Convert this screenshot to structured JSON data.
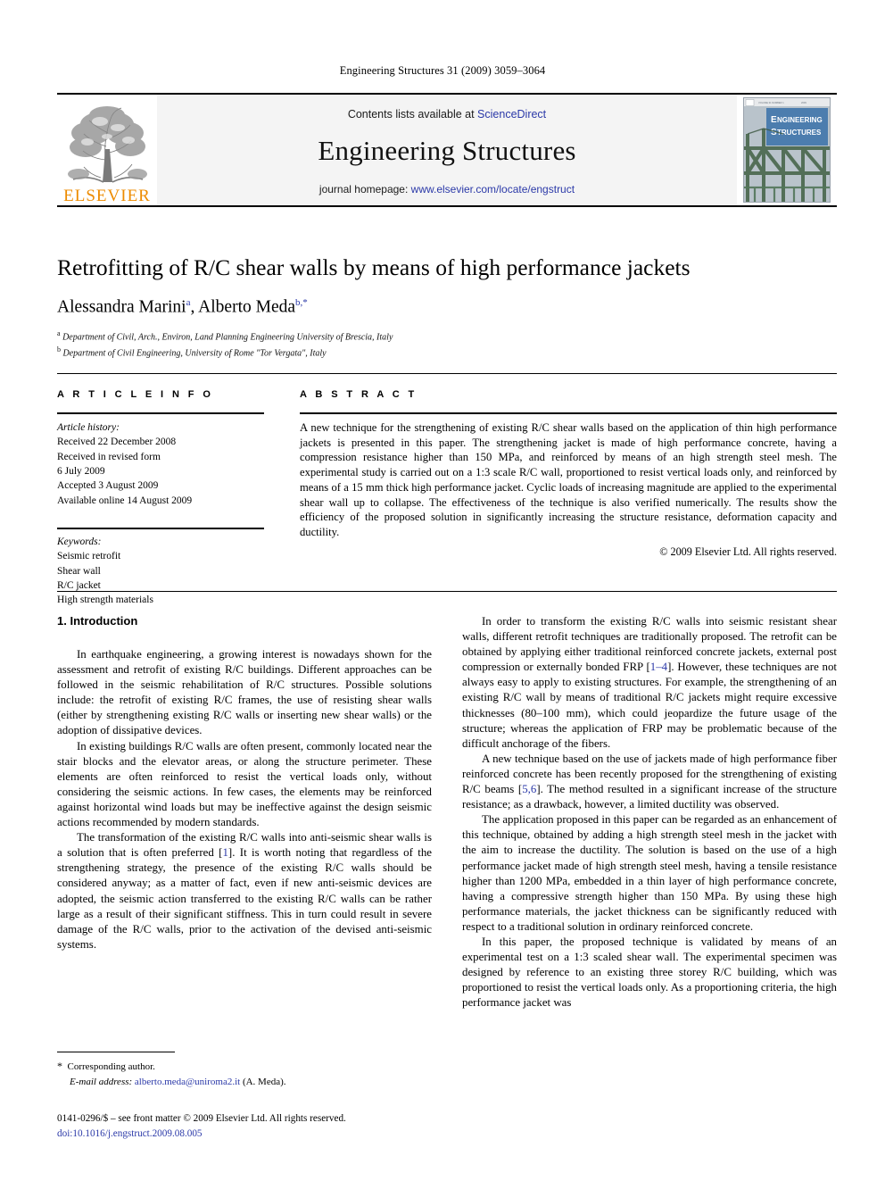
{
  "running_head": "Engineering Structures 31 (2009) 3059–3064",
  "masthead": {
    "publisher_name": "ELSEVIER",
    "publisher_logo_icon": "elsevier-tree-icon",
    "contents_prefix": "Contents lists available at ",
    "contents_link": "ScienceDirect",
    "journal_name": "Engineering Structures",
    "homepage_prefix": "journal homepage: ",
    "homepage_url": "www.elsevier.com/locate/engstruct",
    "cover_title_line1": "ENGINEERING",
    "cover_title_line2": "STRUCTURES",
    "link_color": "#2b39a8",
    "elsevier_orange": "#ED8B00",
    "cover_band_color": "#4a7eb5"
  },
  "article": {
    "title": "Retrofitting of R/C shear walls by means of high performance jackets",
    "authors": [
      {
        "name": "Alessandra Marini",
        "marker": "a"
      },
      {
        "name": "Alberto Meda",
        "marker": "b,*"
      }
    ],
    "affiliations": [
      {
        "marker": "a",
        "text": "Department of Civil, Arch., Environ, Land Planning Engineering University of Brescia, Italy"
      },
      {
        "marker": "b",
        "text": "Department of Civil Engineering, University of Rome \"Tor Vergata\", Italy"
      }
    ]
  },
  "article_info": {
    "heading": "A R T I C L E    I N F O",
    "history_label": "Article history:",
    "history": [
      "Received 22 December 2008",
      "Received in revised form",
      "6 July 2009",
      "Accepted 3 August 2009",
      "Available online 14 August 2009"
    ],
    "keywords_label": "Keywords:",
    "keywords": [
      "Seismic retrofit",
      "Shear wall",
      "R/C jacket",
      "High strength materials"
    ]
  },
  "abstract": {
    "heading": "A B S T R A C T",
    "text": "A new technique for the strengthening of existing R/C shear walls based on the application of thin high performance jackets is presented in this paper. The strengthening jacket is made of high performance concrete, having a compression resistance higher than 150 MPa, and reinforced by means of an high strength steel mesh. The experimental study is carried out on a 1:3 scale R/C wall, proportioned to resist vertical loads only, and reinforced by means of a 15 mm thick high performance jacket. Cyclic loads of increasing magnitude are applied to the experimental shear wall up to collapse. The effectiveness of the technique is also verified numerically. The results show the efficiency of the proposed solution in significantly increasing the structure resistance, deformation capacity and ductility.",
    "copyright": "© 2009 Elsevier Ltd. All rights reserved."
  },
  "body": {
    "section_heading": "1. Introduction",
    "left_paragraphs": [
      "In earthquake engineering, a growing interest is nowadays shown for the assessment and retrofit of existing R/C buildings. Different approaches can be followed in the seismic rehabilitation of R/C structures. Possible solutions include: the retrofit of existing R/C frames, the use of resisting shear walls (either by strengthening existing R/C walls or inserting new shear walls) or the adoption of dissipative devices.",
      "In existing buildings R/C walls are often present, commonly located near the stair blocks and the elevator areas, or along the structure perimeter. These elements are often reinforced to resist the vertical loads only, without considering the seismic actions. In few cases, the elements may be reinforced against horizontal wind loads but may be ineffective against the design seismic actions recommended by modern standards.",
      "The transformation of the existing R/C walls into anti-seismic shear walls is a solution that is often preferred [1]. It is worth noting that regardless of the strengthening strategy, the presence of the existing R/C walls should be considered anyway; as a matter of fact, even if new anti-seismic devices are adopted, the seismic action transferred to the existing R/C walls can be rather large as a result of their significant stiffness. This in turn could result in severe damage of the R/C walls, prior to the activation of the devised anti-seismic systems."
    ],
    "right_paragraphs": [
      "In order to transform the existing R/C walls into seismic resistant shear walls, different retrofit techniques are traditionally proposed. The retrofit can be obtained by applying either traditional reinforced concrete jackets, external post compression or externally bonded FRP [1–4]. However, these techniques are not always easy to apply to existing structures. For example, the strengthening of an existing R/C wall by means of traditional R/C jackets might require excessive thicknesses (80–100 mm), which could jeopardize the future usage of the structure; whereas the application of FRP may be problematic because of the difficult anchorage of the fibers.",
      "A new technique based on the use of jackets made of high performance fiber reinforced concrete has been recently proposed for the strengthening of existing R/C beams [5,6]. The method resulted in a significant increase of the structure resistance; as a drawback, however, a limited ductility was observed.",
      "The application proposed in this paper can be regarded as an enhancement of this technique, obtained by adding a high strength steel mesh in the jacket with the aim to increase the ductility. The solution is based on the use of a high performance jacket made of high strength steel mesh, having a tensile resistance higher than 1200 MPa, embedded in a thin layer of high performance concrete, having a compressive strength higher than 150 MPa. By using these high performance  materials, the jacket thickness can be significantly reduced with respect to a traditional solution in ordinary reinforced concrete.",
      "In this paper, the proposed technique is validated by means of an experimental test on a 1:3 scaled shear wall. The experimental specimen was designed by reference to an existing three storey R/C building, which was proportioned to resist the vertical loads only. As a proportioning criteria, the high performance jacket was"
    ]
  },
  "footnote": {
    "star": "*",
    "corresponding": "Corresponding author.",
    "email_label": "E-mail address:",
    "email": "alberto.meda@uniroma2.it",
    "email_suffix": "(A. Meda)."
  },
  "footer": {
    "issn_line": "0141-0296/$ – see front matter © 2009 Elsevier Ltd. All rights reserved.",
    "doi": "doi:10.1016/j.engstruct.2009.08.005"
  }
}
